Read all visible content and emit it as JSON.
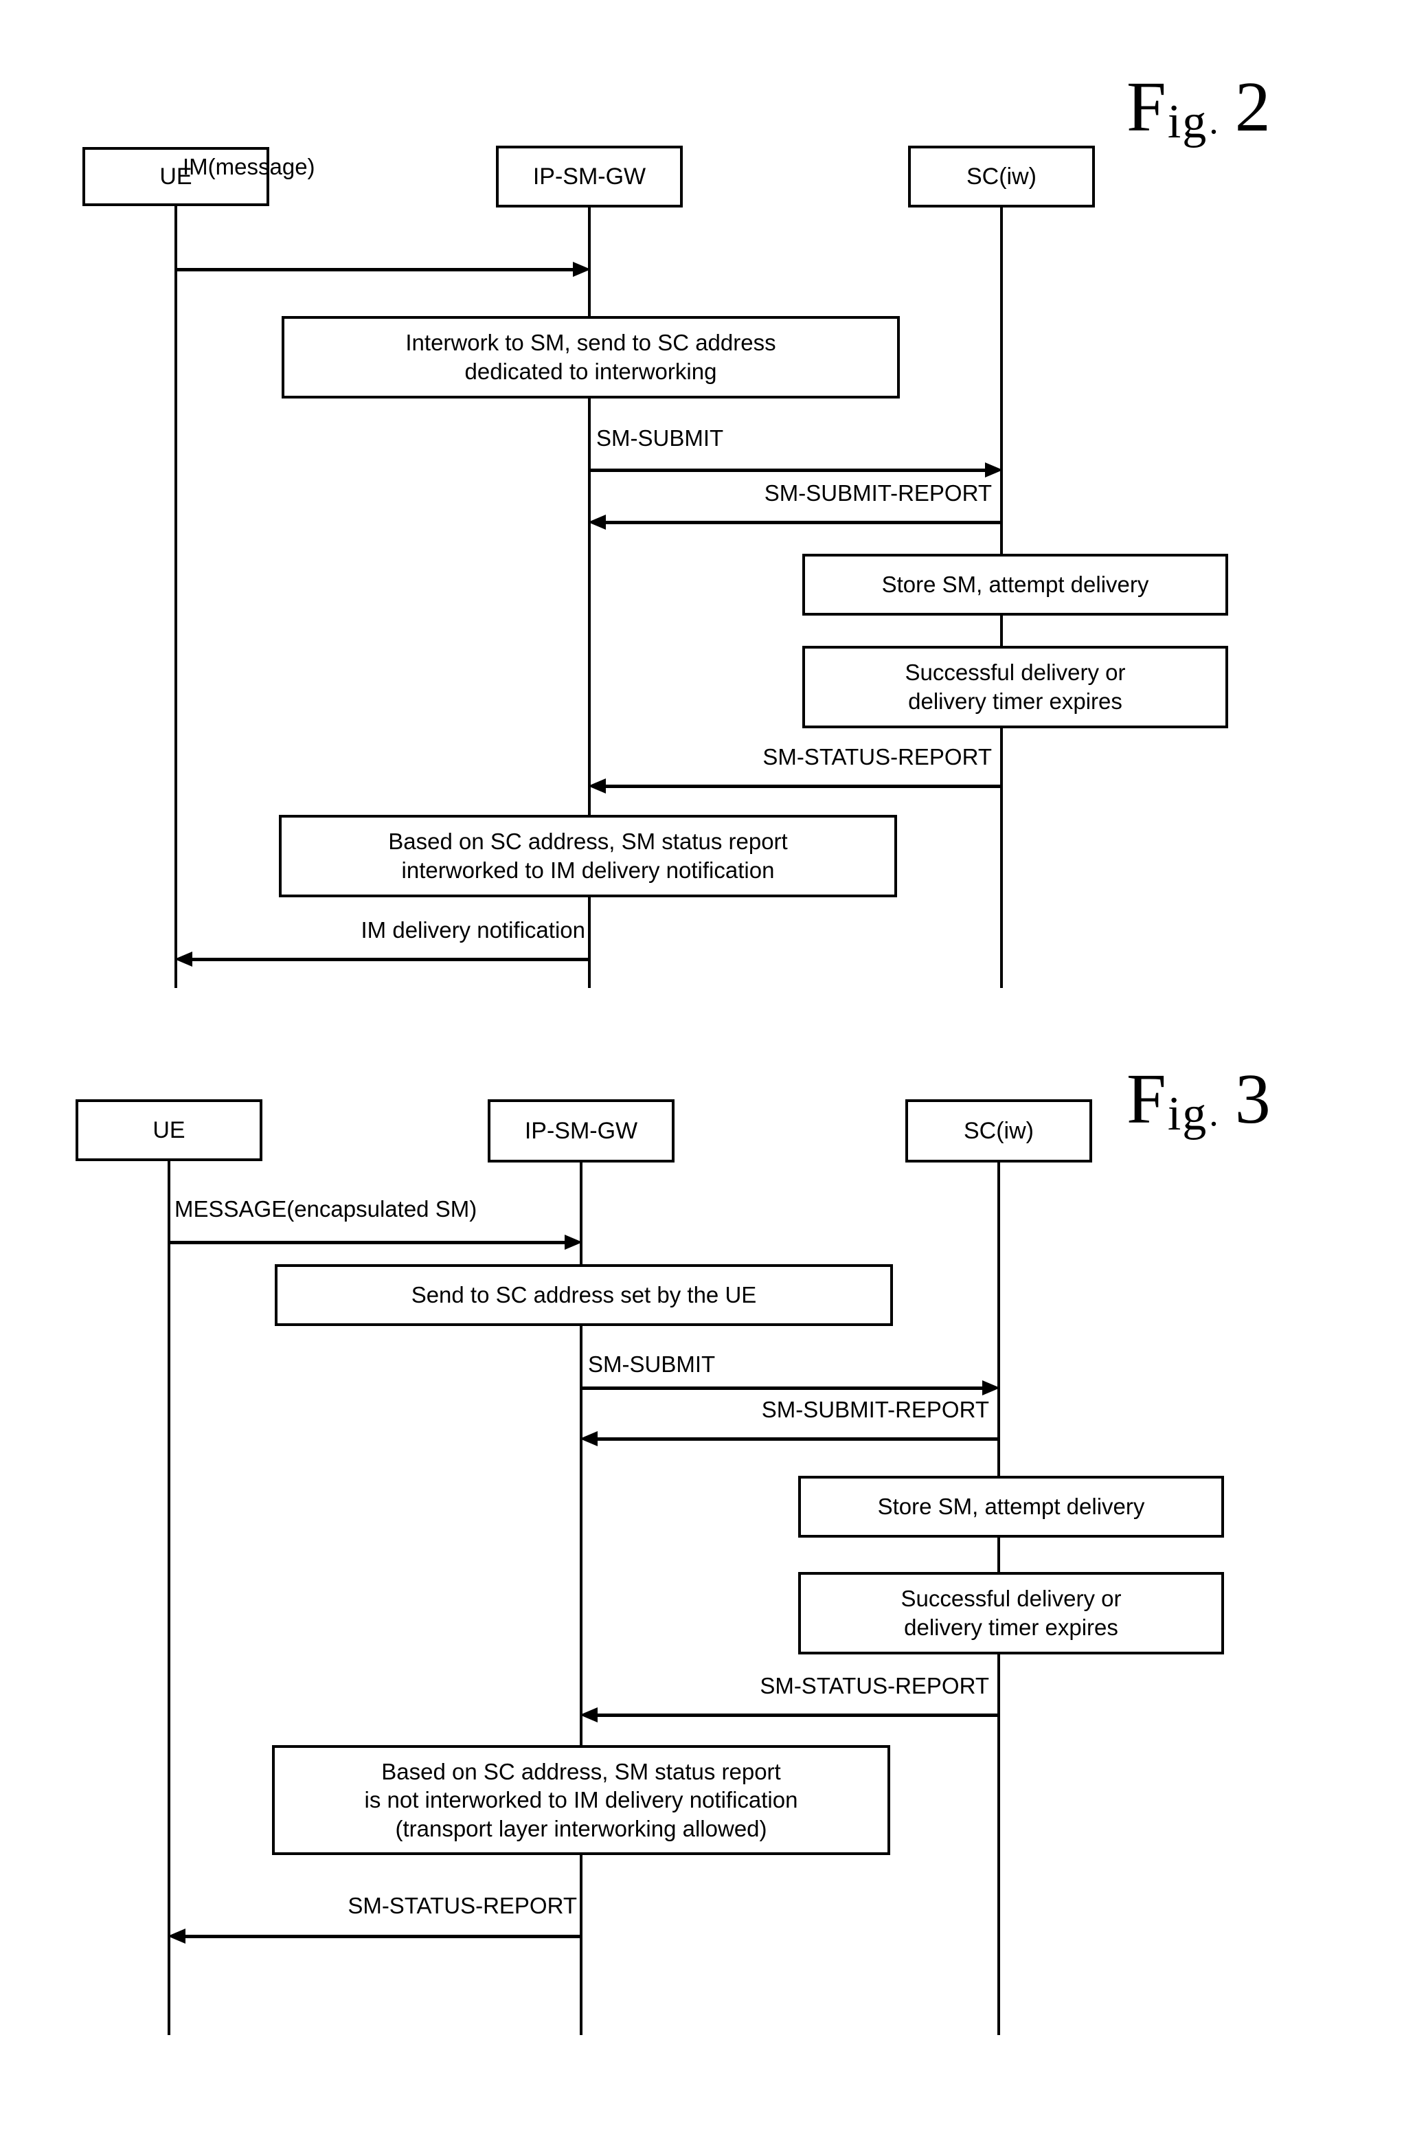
{
  "page": {
    "background": "#ffffff",
    "ink": "#000000"
  },
  "figures": [
    {
      "id": "fig2",
      "label_prefix": "F",
      "label_mid": "ig",
      "label_dot": ".",
      "label_number": "2",
      "actors": [
        {
          "name": "ue",
          "label": "UE"
        },
        {
          "name": "ip-sm-gw",
          "label": "IP-SM-GW"
        },
        {
          "name": "sc-iw",
          "label": "SC(iw)"
        }
      ],
      "messages": [
        {
          "name": "im-message",
          "label": "IM(message)",
          "from": "ue",
          "to": "ip-sm-gw",
          "direction": "right",
          "align": "left"
        },
        {
          "name": "sm-submit",
          "label": "SM-SUBMIT",
          "from": "ip-sm-gw",
          "to": "sc-iw",
          "direction": "right",
          "align": "left"
        },
        {
          "name": "sm-submit-report",
          "label": "SM-SUBMIT-REPORT",
          "from": "sc-iw",
          "to": "ip-sm-gw",
          "direction": "left",
          "align": "right"
        },
        {
          "name": "sm-status-report",
          "label": "SM-STATUS-REPORT",
          "from": "sc-iw",
          "to": "ip-sm-gw",
          "direction": "left",
          "align": "right"
        },
        {
          "name": "im-delivery-notification",
          "label": "IM delivery notification",
          "from": "ip-sm-gw",
          "to": "ue",
          "direction": "left",
          "align": "right"
        }
      ],
      "notes": [
        {
          "name": "note-interwork-to-sm",
          "lines": [
            "Interwork to SM, send to SC address",
            "dedicated to interworking"
          ]
        },
        {
          "name": "note-store-sm",
          "lines": [
            "Store SM, attempt delivery"
          ]
        },
        {
          "name": "note-successful-delivery",
          "lines": [
            "Successful delivery or",
            "delivery timer expires"
          ]
        },
        {
          "name": "note-based-on-sc-address",
          "lines": [
            "Based on SC address, SM status report",
            "interworked to IM delivery notification"
          ]
        }
      ]
    },
    {
      "id": "fig3",
      "label_prefix": "F",
      "label_mid": "ig",
      "label_dot": ".",
      "label_number": "3",
      "actors": [
        {
          "name": "ue",
          "label": "UE"
        },
        {
          "name": "ip-sm-gw",
          "label": "IP-SM-GW"
        },
        {
          "name": "sc-iw",
          "label": "SC(iw)"
        }
      ],
      "messages": [
        {
          "name": "message-encapsulated-sm",
          "label": "MESSAGE(encapsulated SM)",
          "from": "ue",
          "to": "ip-sm-gw",
          "direction": "right",
          "align": "left"
        },
        {
          "name": "sm-submit",
          "label": "SM-SUBMIT",
          "from": "ip-sm-gw",
          "to": "sc-iw",
          "direction": "right",
          "align": "left"
        },
        {
          "name": "sm-submit-report",
          "label": "SM-SUBMIT-REPORT",
          "from": "sc-iw",
          "to": "ip-sm-gw",
          "direction": "left",
          "align": "right"
        },
        {
          "name": "sm-status-report",
          "label": "SM-STATUS-REPORT",
          "from": "sc-iw",
          "to": "ip-sm-gw",
          "direction": "left",
          "align": "right"
        },
        {
          "name": "sm-status-report-to-ue",
          "label": "SM-STATUS-REPORT",
          "from": "ip-sm-gw",
          "to": "ue",
          "direction": "left",
          "align": "right"
        }
      ],
      "notes": [
        {
          "name": "note-send-to-sc-address",
          "lines": [
            "Send to SC address set by the UE"
          ]
        },
        {
          "name": "note-store-sm",
          "lines": [
            "Store SM, attempt delivery"
          ]
        },
        {
          "name": "note-successful-delivery",
          "lines": [
            "Successful delivery or",
            "delivery timer expires"
          ]
        },
        {
          "name": "note-based-on-sc-address",
          "lines": [
            "Based on SC address, SM status report",
            "is not interworked to IM delivery notification",
            "(transport layer interworking allowed)"
          ]
        }
      ]
    }
  ]
}
